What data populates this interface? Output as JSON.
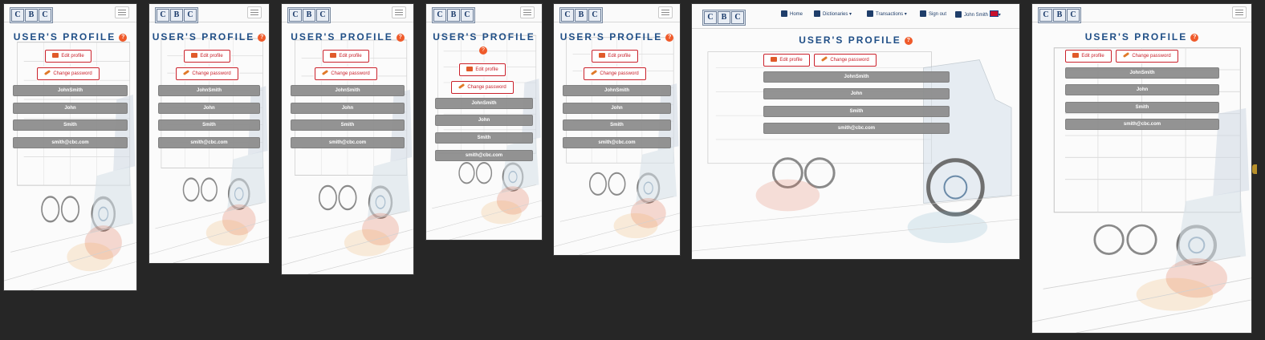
{
  "logo_letters": [
    "C",
    "B",
    "C"
  ],
  "page_title": "USER'S PROFILE",
  "help_symbol": "?",
  "buttons": {
    "edit_profile": "Edit profile",
    "change_password": "Change password"
  },
  "profile": {
    "username": "JohnSmith",
    "first_name": "John",
    "last_name": "Smith",
    "email": "smith@cbc.com"
  },
  "desktop_nav": {
    "home": "Home",
    "dictionaries": "Dictionaries",
    "transactions": "Transactions",
    "sign_out": "Sign out",
    "user": "John Smith"
  },
  "colors": {
    "title": "#1f4e86",
    "accent_red": "#c9202a",
    "help_orange": "#ef5a2a",
    "field_gray": "#8e8e8e",
    "background": "#262626"
  }
}
